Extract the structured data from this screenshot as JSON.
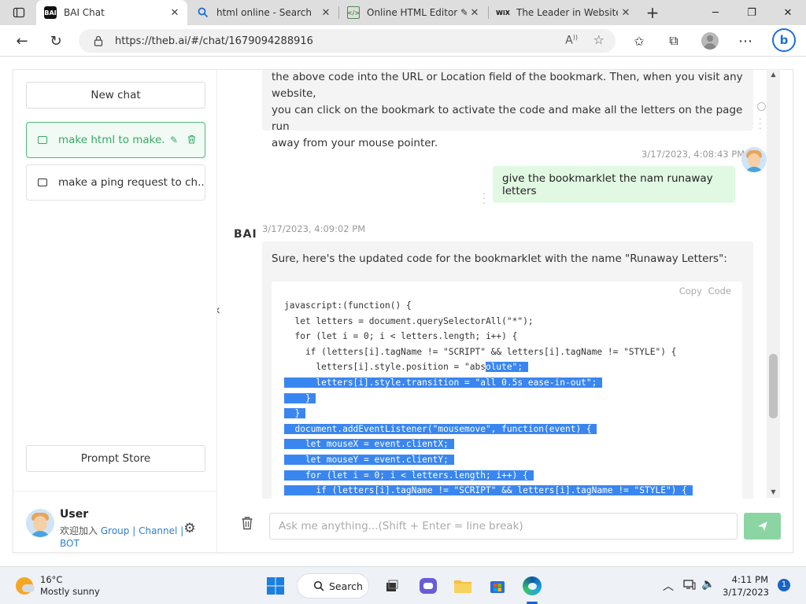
{
  "browser": {
    "tabs": [
      {
        "title": "BAI Chat",
        "icon": "bai-favicon",
        "active": true
      },
      {
        "title": "html online - Search",
        "icon": "search-favicon",
        "active": false
      },
      {
        "title": "Online HTML Editor ✎ |",
        "icon": "html-editor-favicon",
        "active": false
      },
      {
        "title": "The Leader in Website C",
        "icon": "wix-favicon",
        "active": false
      }
    ],
    "url": "https://theb.ai/#/chat/1679094288916"
  },
  "sidebar": {
    "new_chat": "New chat",
    "chats": [
      {
        "title": "make html to make...",
        "active": true
      },
      {
        "title": "make a ping request to ch...",
        "active": false
      }
    ],
    "prompt_store": "Prompt Store",
    "user": {
      "name": "User",
      "welcome": "欢迎加入",
      "group": "Group",
      "channel": "Channel",
      "sep": "|",
      "bot": "BOT"
    }
  },
  "chat": {
    "prev_reply_lines": [
      "the above code into the URL or Location field of the bookmark. Then, when you visit any website,",
      "you can click on the bookmark to activate the code and make all the letters on the page run",
      "away from your mouse pointer."
    ],
    "user_msg": {
      "time": "3/17/2023, 4:08:43 PM",
      "text": "give the bookmarklet the nam runaway letters"
    },
    "bot_msg": {
      "label": "BAI",
      "time": "3/17/2023, 4:09:02 PM",
      "intro": "Sure, here's the updated code for the bookmarklet with the name \"Runaway Letters\":",
      "copy_code": "Copy  Code",
      "code_lines": [
        {
          "plain": "javascript:(function() {",
          "sel": ""
        },
        {
          "plain": "  let letters = document.querySelectorAll(\"*\");",
          "sel": ""
        },
        {
          "plain": "  for (let i = 0; i < letters.length; i++) {",
          "sel": ""
        },
        {
          "plain": "    if (letters[i].tagName != \"SCRIPT\" && letters[i].tagName != \"STYLE\") {",
          "sel": ""
        },
        {
          "plain": "      letters[i].style.position = \"abs",
          "sel": "olute\";"
        },
        {
          "plain": "",
          "sel": "      letters[i].style.transition = \"all 0.5s ease-in-out\";"
        },
        {
          "plain": "",
          "sel": "    }"
        },
        {
          "plain": "",
          "sel": "  }"
        },
        {
          "plain": "",
          "sel": "  document.addEventListener(\"mousemove\", function(event) {"
        },
        {
          "plain": "",
          "sel": "    let mouseX = event.clientX;"
        },
        {
          "plain": "",
          "sel": "    let mouseY = event.clientY;"
        },
        {
          "plain": "",
          "sel": "    for (let i = 0; i < letters.length; i++) {"
        },
        {
          "plain": "",
          "sel": "      if (letters[i].tagName != \"SCRIPT\" && letters[i].tagName != \"STYLE\") {"
        }
      ]
    },
    "input_placeholder": "Ask me anything...(Shift + Enter = line break)"
  },
  "taskbar": {
    "temp": "16°C",
    "weather": "Mostly sunny",
    "search": "Search",
    "time": "4:11 PM",
    "date": "3/17/2023",
    "notifications": "1"
  },
  "colors": {
    "accent_green": "#37a964",
    "selection_blue": "#3a86f0",
    "user_bubble": "#e1f8e3"
  }
}
